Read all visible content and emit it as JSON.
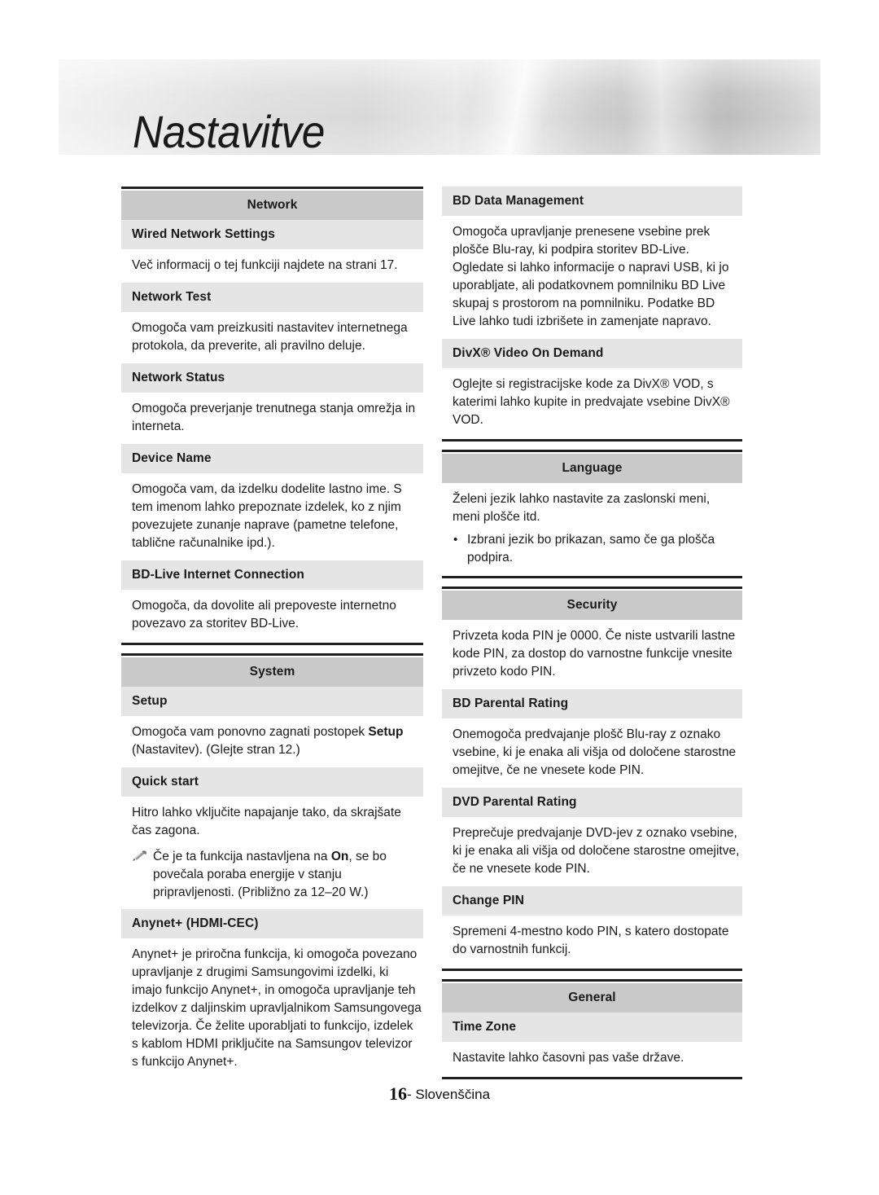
{
  "header": {
    "title": "Nastavitve"
  },
  "footer": {
    "page_number": "16",
    "separator": "-",
    "language": "Slovenščina"
  },
  "icons": {
    "note": "pencil-icon",
    "bullet": "•"
  },
  "left_column": {
    "sections": [
      {
        "name": "network",
        "heading": "Network",
        "entries": [
          {
            "heading": "Wired Network Settings",
            "body": "Več informacij o tej funkciji najdete na strani 17."
          },
          {
            "heading": "Network Test",
            "body": "Omogoča vam preizkusiti nastavitev internetnega protokola, da preverite, ali pravilno deluje."
          },
          {
            "heading": "Network Status",
            "body": "Omogoča preverjanje trenutnega stanja omrežja in interneta."
          },
          {
            "heading": "Device Name",
            "body": "Omogoča vam, da izdelku dodelite lastno ime. S tem imenom lahko prepoznate izdelek, ko z njim povezujete zunanje naprave (pametne telefone, tablične računalnike ipd.)."
          },
          {
            "heading": "BD-Live Internet Connection",
            "body": "Omogoča, da dovolite ali prepoveste internetno povezavo za storitev BD-Live."
          }
        ]
      },
      {
        "name": "system",
        "heading": "System",
        "entries": [
          {
            "heading": "Setup",
            "body_pre": "Omogoča vam ponovno zagnati postopek ",
            "body_bold": "Setup",
            "body_post": " (Nastavitev). (Glejte stran 12.)"
          },
          {
            "heading": "Quick start",
            "body": "Hitro lahko vključite napajanje tako, da skrajšate čas zagona.",
            "note_pre": "Če je ta funkcija nastavljena na ",
            "note_bold": "On",
            "note_post": ", se bo povečala poraba energije v stanju pripravljenosti. (Približno za 12–20 W.)"
          },
          {
            "heading": "Anynet+ (HDMI-CEC)",
            "body": "Anynet+ je priročna funkcija, ki omogoča povezano upravljanje z drugimi Samsungovimi izdelki, ki imajo funkcijo Anynet+, in omogoča upravljanje teh izdelkov z daljinskim upravljalnikom Samsungovega televizorja. Če želite uporabljati to funkcijo, izdelek s kablom HDMI priključite na Samsungov televizor s funkcijo Anynet+."
          }
        ]
      }
    ]
  },
  "right_column": {
    "continued_entries": [
      {
        "heading": "BD Data Management",
        "body": "Omogoča upravljanje prenesene vsebine prek plošče Blu-ray, ki podpira storitev BD-Live. Ogledate si lahko informacije o napravi USB, ki jo uporabljate, ali podatkovnem pomnilniku BD Live skupaj s prostorom na pomnilniku. Podatke BD Live lahko tudi izbrišete in zamenjate napravo."
      },
      {
        "heading": "DivX® Video On Demand",
        "body": "Oglejte si registracijske kode za DivX® VOD, s katerimi lahko kupite in predvajate vsebine DivX® VOD."
      }
    ],
    "sections": [
      {
        "name": "language",
        "heading": "Language",
        "intro": "Želeni jezik lahko nastavite za zaslonski meni, meni plošče itd.",
        "bullets": [
          "Izbrani jezik bo prikazan, samo če ga plošča podpira."
        ]
      },
      {
        "name": "security",
        "heading": "Security",
        "intro": "Privzeta koda PIN je 0000. Če niste ustvarili lastne kode PIN, za dostop do varnostne funkcije vnesite privzeto kodo PIN.",
        "entries": [
          {
            "heading": "BD Parental Rating",
            "body": "Onemogoča predvajanje plošč Blu-ray z oznako vsebine, ki je enaka ali višja od določene starostne omejitve, če ne vnesete kode PIN."
          },
          {
            "heading": "DVD Parental Rating",
            "body": "Preprečuje predvajanje DVD-jev z oznako vsebine, ki je enaka ali višja od določene starostne omejitve, če ne vnesete kode PIN."
          },
          {
            "heading": "Change PIN",
            "body": "Spremeni 4-mestno kodo PIN, s katero dostopate do varnostnih funkcij."
          }
        ]
      },
      {
        "name": "general",
        "heading": "General",
        "entries": [
          {
            "heading": "Time Zone",
            "body": "Nastavite lahko časovni pas vaše države."
          }
        ]
      }
    ]
  }
}
